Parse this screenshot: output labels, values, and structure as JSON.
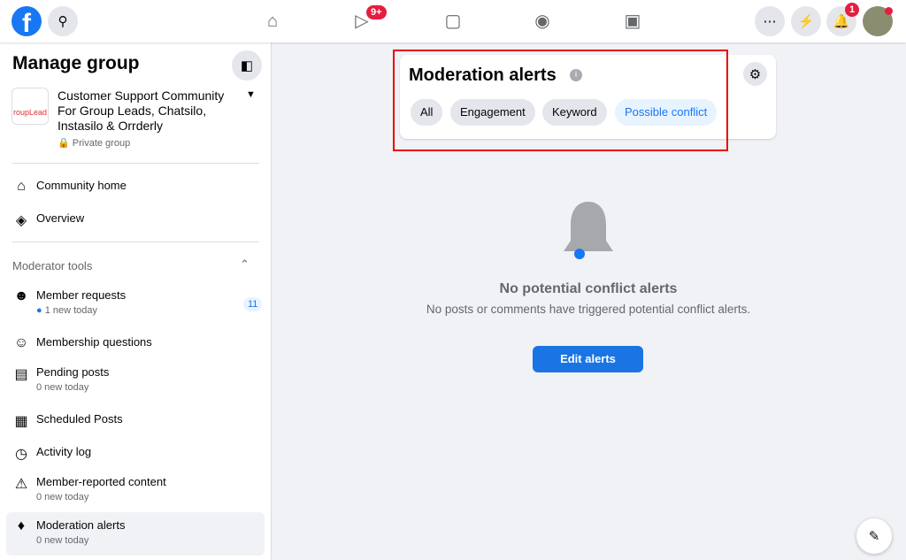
{
  "topbar": {
    "logo": "f",
    "video_badge": "9+",
    "notif_badge": "1",
    "icons": [
      "home-icon",
      "video-icon",
      "marketplace-icon",
      "groups-icon",
      "gaming-icon",
      "menu-grid-icon",
      "messenger-icon",
      "bell-icon"
    ]
  },
  "sidebar": {
    "title": "Manage group",
    "group_name": "Customer Support Community For Group Leads, Chatsilo, Instasilo & Orrderly",
    "group_logo_text": "roupLead",
    "privacy": "Private group",
    "nav": [
      {
        "label": "Community home"
      },
      {
        "label": "Overview"
      }
    ],
    "section": "Moderator tools",
    "tools": [
      {
        "label": "Member requests",
        "sub": "1 new today",
        "badge": "11"
      },
      {
        "label": "Membership questions"
      },
      {
        "label": "Pending posts",
        "sub": "0 new today"
      },
      {
        "label": "Scheduled Posts"
      },
      {
        "label": "Activity log"
      },
      {
        "label": "Member-reported content",
        "sub": "0 new today"
      },
      {
        "label": "Moderation alerts",
        "sub": "0 new today"
      }
    ]
  },
  "main": {
    "title": "Moderation alerts",
    "filters": [
      "All",
      "Engagement",
      "Keyword",
      "Possible conflict"
    ],
    "selected_filter": "Possible conflict",
    "empty_title": "No potential conflict alerts",
    "empty_desc": "No posts or comments have triggered potential conflict alerts.",
    "button": "Edit alerts"
  },
  "colors": {
    "accent": "#1b74e4",
    "highlight": "#e00000"
  }
}
